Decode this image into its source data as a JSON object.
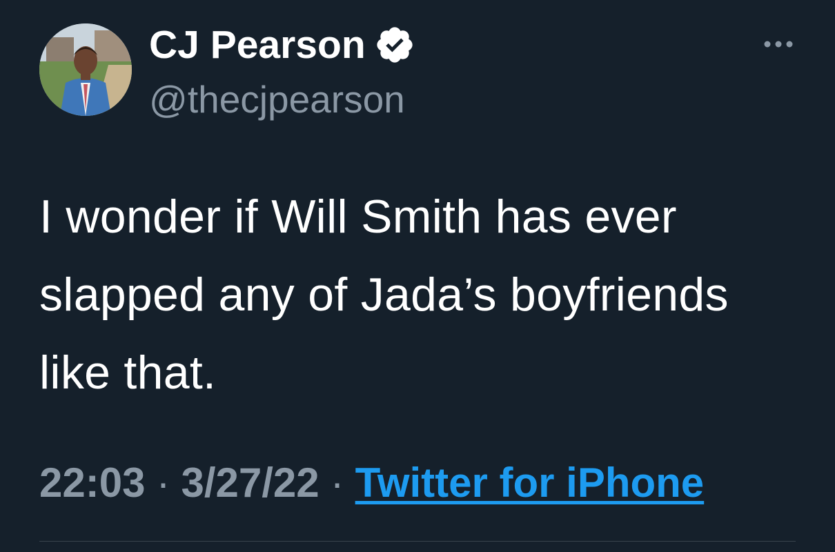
{
  "tweet": {
    "author": {
      "display_name": "CJ Pearson",
      "handle": "@thecjpearson",
      "verified": true
    },
    "text": "I wonder if Will Smith has ever slapped any of Jada’s boyfriends like that.",
    "time": "22:03",
    "date": "3/27/22",
    "separator": "·",
    "source": "Twitter for iPhone"
  },
  "icons": {
    "verified": "verified-badge-icon",
    "more": "more-horizontal-icon"
  },
  "colors": {
    "background": "#15202b",
    "text": "#ffffff",
    "secondary_text": "#8b98a5",
    "link": "#1d9bf0",
    "divider": "#38444d"
  }
}
